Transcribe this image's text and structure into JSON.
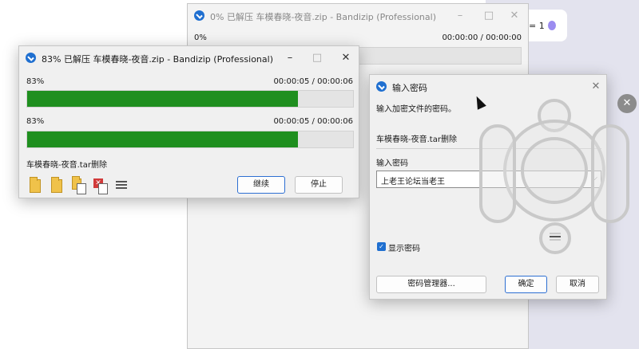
{
  "background": {
    "pill_text": "= 1"
  },
  "back_window": {
    "title": "0% 已解压 车模春晓-夜音.zip - Bandizip (Professional)",
    "percent": "0%",
    "time": "00:00:00 / 00:00:00"
  },
  "main_window": {
    "title": "83% 已解压 车模春晓-夜音.zip - Bandizip (Professional)",
    "rows": [
      {
        "percent": "83%",
        "time": "00:00:05 / 00:00:06",
        "progress": 0.83
      },
      {
        "percent": "83%",
        "time": "00:00:05 / 00:00:06",
        "progress": 0.83
      }
    ],
    "file_label": "车模春晓-夜音.tar删除",
    "toolbar_icons": [
      "open-folder-icon",
      "folder-icon",
      "copy-folder-icon",
      "delete-icon",
      "menu-icon"
    ],
    "continue_label": "继续",
    "stop_label": "停止"
  },
  "password_dialog": {
    "title": "输入密码",
    "prompt": "输入加密文件的密码。",
    "file_name": "车模春晓-夜音.tar删除",
    "field_label": "输入密码",
    "password_value": "上老王论坛当老王",
    "show_password_label": "显示密码",
    "show_password_checked": true,
    "manager_label": "密码管理器...",
    "ok_label": "确定",
    "cancel_label": "取消"
  },
  "colors": {
    "progress_fill": "#1f8f1f",
    "accent": "#1f6fd0"
  }
}
